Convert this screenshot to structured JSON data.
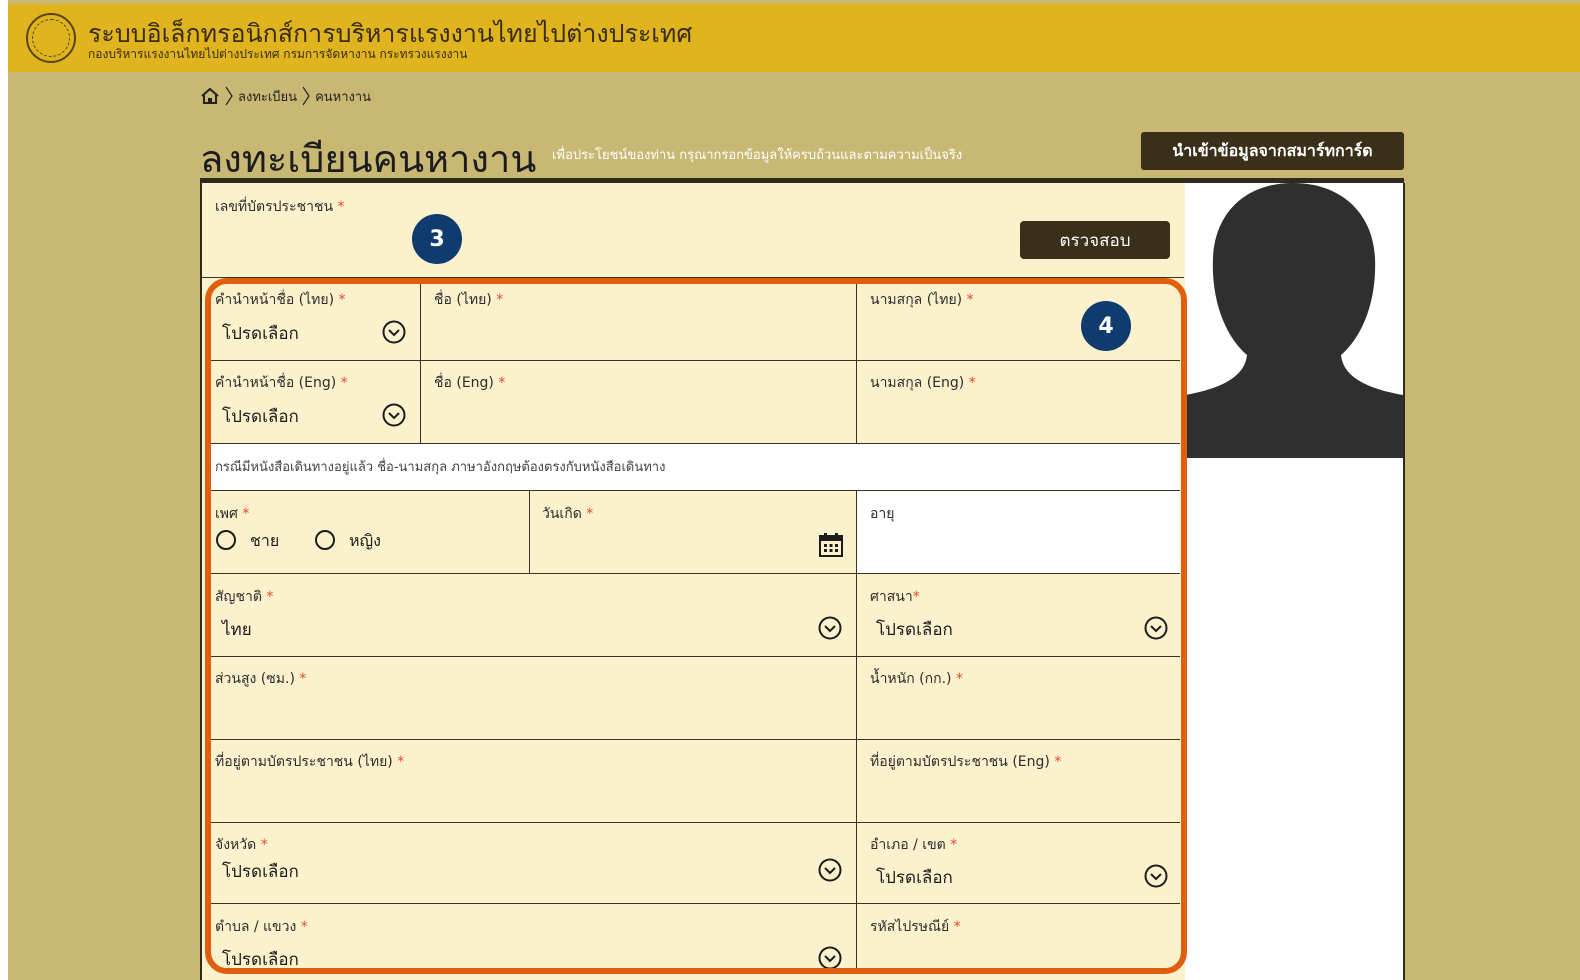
{
  "header": {
    "title": "ระบบอิเล็กทรอนิกส์การบริหารแรงงานไทยไปต่างประเทศ",
    "subtitle": "กองบริหารแรงงานไทยไปต่างประเทศ กรมการจัดหางาน กระทรวงแรงงาน"
  },
  "breadcrumb": {
    "items": [
      "ลงทะเบียน",
      "คนหางาน"
    ]
  },
  "page": {
    "title": "ลงทะเบียนคนหางาน",
    "subtitle": "เพื่อประโยชน์ของท่าน กรุณากรอกข้อมูลให้ครบถ้วนและตามความเป็นจริง",
    "smartcard_button": "นำเข้าข้อมูลจากสมาร์ทการ์ด"
  },
  "form": {
    "id_card": {
      "label": "เลขที่บัตรประชาชน",
      "required": "*",
      "value": ""
    },
    "check_button": "ตรวจสอบ",
    "badges": [
      "3",
      "4"
    ],
    "title_th": {
      "label": "คำนำหน้าชื่อ (ไทย)",
      "required": "*",
      "value": "โปรดเลือก"
    },
    "first_th": {
      "label": "ชื่อ (ไทย)",
      "required": "*",
      "value": ""
    },
    "last_th": {
      "label": "นามสกุล (ไทย)",
      "required": "*",
      "value": ""
    },
    "title_en": {
      "label": "คำนำหน้าชื่อ (Eng)",
      "required": "*",
      "value": "โปรดเลือก"
    },
    "first_en": {
      "label": "ชื่อ (Eng)",
      "required": "*",
      "value": ""
    },
    "last_en": {
      "label": "นามสกุล (Eng)",
      "required": "*",
      "value": ""
    },
    "passport_note": "กรณีมีหนังสือเดินทางอยู่แล้ว ชื่อ-นามสกุล ภาษาอังกฤษต้องตรงกับหนังสือเดินทาง",
    "gender": {
      "label": "เพศ",
      "required": "*",
      "options": [
        "ชาย",
        "หญิง"
      ]
    },
    "birthdate": {
      "label": "วันเกิด",
      "required": "*",
      "value": ""
    },
    "age": {
      "label": "อายุ",
      "value": ""
    },
    "nationality": {
      "label": "สัญชาติ",
      "required": "*",
      "value": "ไทย"
    },
    "religion": {
      "label": "ศาสนา",
      "required": "*",
      "value": "โปรดเลือก"
    },
    "height": {
      "label": "ส่วนสูง (ซม.)",
      "required": "*",
      "value": ""
    },
    "weight": {
      "label": "น้ำหนัก (กก.)",
      "required": "*",
      "value": ""
    },
    "address_th": {
      "label": "ที่อยู่ตามบัตรประชาชน (ไทย)",
      "required": "*",
      "value": ""
    },
    "address_en": {
      "label": "ที่อยู่ตามบัตรประชาชน (Eng)",
      "required": "*",
      "value": ""
    },
    "province": {
      "label": "จังหวัด",
      "required": "*",
      "value": "โปรดเลือก"
    },
    "district": {
      "label": "อำเภอ / เขต",
      "required": "*",
      "value": "โปรดเลือก"
    },
    "subdistrict": {
      "label": "ตำบล / แขวง",
      "required": "*",
      "value": "โปรดเลือก"
    },
    "postcode": {
      "label": "รหัสไปรษณีย์",
      "required": "*",
      "value": ""
    }
  },
  "colors": {
    "header_bg": "#dfb41f",
    "page_bg": "#c8b873",
    "form_bg": "#fbf2cd",
    "highlight": "#e05f0e",
    "badge": "#0f3b6e",
    "button": "#3a2f18"
  }
}
